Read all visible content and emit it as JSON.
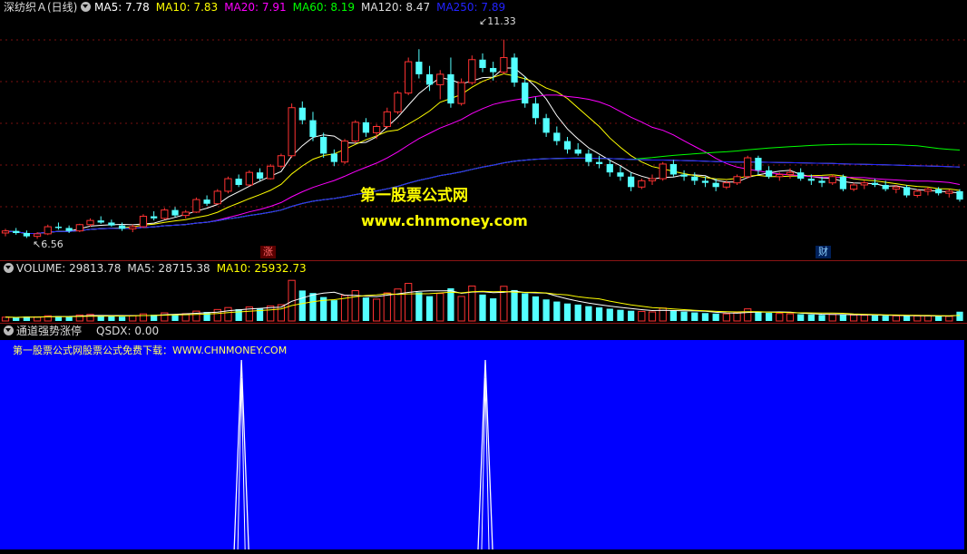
{
  "main": {
    "title": "深纺织Ａ(日线)",
    "ma_legend": [
      {
        "label": "MA5: 7.78",
        "color": "#ffffff"
      },
      {
        "label": "MA10: 7.83",
        "color": "#ffff00"
      },
      {
        "label": "MA20: 7.91",
        "color": "#ff00ff"
      },
      {
        "label": "MA60: 8.19",
        "color": "#00ff00"
      },
      {
        "label": "MA120: 8.47",
        "color": "#dddddd"
      },
      {
        "label": "MA250: 7.89",
        "color": "#2222ff"
      }
    ],
    "high_label": "11.33",
    "low_label": "6.56",
    "tag_zhang": "涨",
    "tag_cai": "财",
    "watermark_title": "第一股票公式网",
    "watermark_url": "www.chnmoney.com"
  },
  "volume": {
    "legend": [
      {
        "label": "VOLUME: 29813.78",
        "color": "#dddddd"
      },
      {
        "label": "MA5: 28715.38",
        "color": "#dddddd"
      },
      {
        "label": "MA10: 25932.73",
        "color": "#ffff00"
      }
    ]
  },
  "indicator": {
    "name": "通道强势涨停",
    "value_label": "QSDX: 0.00",
    "banner": "第一股票公式网股票公式免费下载：WWW.CHNMONEY.COM"
  },
  "colors": {
    "up": "#ff3232",
    "down": "#54ffff",
    "indicator_bg": "#0000ff",
    "separator": "#8a1414"
  },
  "chart_data": {
    "type": "candlestick",
    "price_range": [
      6.2,
      11.8
    ],
    "candles": [
      [
        6.7,
        6.8,
        6.62,
        6.75
      ],
      [
        6.75,
        6.82,
        6.66,
        6.7
      ],
      [
        6.7,
        6.76,
        6.58,
        6.62
      ],
      [
        6.62,
        6.72,
        6.56,
        6.68
      ],
      [
        6.68,
        6.9,
        6.65,
        6.85
      ],
      [
        6.85,
        6.95,
        6.78,
        6.82
      ],
      [
        6.82,
        6.88,
        6.7,
        6.75
      ],
      [
        6.75,
        6.92,
        6.72,
        6.9
      ],
      [
        6.9,
        7.05,
        6.85,
        7.0
      ],
      [
        7.0,
        7.1,
        6.92,
        6.95
      ],
      [
        6.95,
        7.02,
        6.85,
        6.88
      ],
      [
        6.88,
        6.95,
        6.75,
        6.8
      ],
      [
        6.8,
        6.9,
        6.72,
        6.85
      ],
      [
        6.85,
        7.15,
        6.82,
        7.1
      ],
      [
        7.1,
        7.22,
        7.0,
        7.05
      ],
      [
        7.05,
        7.3,
        7.02,
        7.25
      ],
      [
        7.25,
        7.32,
        7.08,
        7.12
      ],
      [
        7.12,
        7.25,
        7.05,
        7.2
      ],
      [
        7.2,
        7.55,
        7.18,
        7.5
      ],
      [
        7.5,
        7.6,
        7.35,
        7.4
      ],
      [
        7.4,
        7.75,
        7.38,
        7.7
      ],
      [
        7.7,
        8.05,
        7.65,
        8.0
      ],
      [
        8.0,
        8.1,
        7.8,
        7.85
      ],
      [
        7.85,
        8.2,
        7.82,
        8.15
      ],
      [
        8.15,
        8.25,
        7.95,
        8.0
      ],
      [
        8.0,
        8.35,
        7.98,
        8.3
      ],
      [
        8.3,
        8.6,
        8.25,
        8.55
      ],
      [
        8.55,
        9.8,
        8.5,
        9.7
      ],
      [
        9.7,
        9.85,
        9.3,
        9.4
      ],
      [
        9.4,
        9.6,
        8.9,
        9.0
      ],
      [
        9.0,
        9.1,
        8.5,
        8.6
      ],
      [
        8.6,
        8.7,
        8.3,
        8.4
      ],
      [
        8.4,
        8.95,
        8.35,
        8.9
      ],
      [
        8.9,
        9.4,
        8.85,
        9.35
      ],
      [
        9.35,
        9.45,
        9.0,
        9.1
      ],
      [
        9.1,
        9.3,
        8.95,
        9.25
      ],
      [
        9.25,
        9.7,
        9.2,
        9.6
      ],
      [
        9.6,
        10.1,
        9.55,
        10.05
      ],
      [
        10.05,
        10.9,
        10.0,
        10.8
      ],
      [
        10.8,
        11.1,
        10.4,
        10.5
      ],
      [
        10.5,
        10.7,
        10.1,
        10.25
      ],
      [
        10.25,
        10.6,
        9.9,
        10.5
      ],
      [
        10.5,
        10.9,
        9.7,
        9.8
      ],
      [
        9.8,
        10.4,
        9.75,
        10.3
      ],
      [
        10.3,
        10.95,
        10.25,
        10.85
      ],
      [
        10.85,
        11.0,
        10.55,
        10.65
      ],
      [
        10.65,
        10.8,
        10.35,
        10.55
      ],
      [
        10.55,
        11.33,
        10.5,
        10.9
      ],
      [
        10.9,
        11.0,
        10.2,
        10.3
      ],
      [
        10.3,
        10.45,
        9.7,
        9.8
      ],
      [
        9.8,
        9.95,
        9.3,
        9.45
      ],
      [
        9.45,
        9.55,
        9.0,
        9.1
      ],
      [
        9.1,
        9.25,
        8.8,
        8.9
      ],
      [
        8.9,
        9.0,
        8.6,
        8.7
      ],
      [
        8.7,
        8.85,
        8.55,
        8.6
      ],
      [
        8.6,
        8.7,
        8.3,
        8.4
      ],
      [
        8.4,
        8.55,
        8.25,
        8.35
      ],
      [
        8.35,
        8.45,
        8.05,
        8.15
      ],
      [
        8.15,
        8.3,
        7.95,
        8.05
      ],
      [
        8.05,
        8.15,
        7.7,
        7.8
      ],
      [
        7.8,
        8.0,
        7.75,
        7.95
      ],
      [
        7.95,
        8.1,
        7.85,
        8.0
      ],
      [
        8.0,
        8.4,
        7.95,
        8.35
      ],
      [
        8.35,
        8.45,
        8.05,
        8.1
      ],
      [
        8.1,
        8.2,
        7.95,
        8.05
      ],
      [
        8.05,
        8.15,
        7.85,
        7.95
      ],
      [
        7.95,
        8.05,
        7.8,
        7.9
      ],
      [
        7.9,
        8.0,
        7.7,
        7.8
      ],
      [
        7.8,
        7.95,
        7.75,
        7.9
      ],
      [
        7.9,
        8.1,
        7.85,
        8.05
      ],
      [
        8.05,
        8.55,
        8.0,
        8.5
      ],
      [
        8.5,
        8.55,
        8.1,
        8.2
      ],
      [
        8.2,
        8.3,
        8.0,
        8.05
      ],
      [
        8.05,
        8.15,
        7.95,
        8.1
      ],
      [
        8.1,
        8.25,
        8.0,
        8.15
      ],
      [
        8.15,
        8.25,
        7.95,
        8.0
      ],
      [
        8.0,
        8.1,
        7.85,
        7.95
      ],
      [
        7.95,
        8.05,
        7.8,
        7.9
      ],
      [
        7.9,
        8.1,
        7.85,
        8.05
      ],
      [
        8.05,
        8.1,
        7.7,
        7.75
      ],
      [
        7.75,
        7.9,
        7.7,
        7.85
      ],
      [
        7.85,
        7.95,
        7.75,
        7.9
      ],
      [
        7.9,
        8.0,
        7.8,
        7.85
      ],
      [
        7.85,
        7.95,
        7.7,
        7.75
      ],
      [
        7.75,
        7.85,
        7.65,
        7.8
      ],
      [
        7.8,
        7.85,
        7.55,
        7.6
      ],
      [
        7.6,
        7.75,
        7.55,
        7.7
      ],
      [
        7.7,
        7.8,
        7.6,
        7.75
      ],
      [
        7.75,
        7.8,
        7.6,
        7.65
      ],
      [
        7.65,
        7.75,
        7.55,
        7.7
      ],
      [
        7.7,
        7.75,
        7.45,
        7.5
      ]
    ],
    "volume_range": [
      0,
      60000
    ],
    "volumes": [
      5200,
      4800,
      6100,
      5500,
      7200,
      6800,
      5900,
      8300,
      9100,
      7800,
      6500,
      6000,
      7400,
      9800,
      8600,
      11200,
      9400,
      10100,
      13600,
      12400,
      15800,
      18500,
      16200,
      19300,
      17100,
      20800,
      22400,
      56000,
      42000,
      38500,
      33000,
      28600,
      35200,
      41800,
      32400,
      30100,
      38700,
      44100,
      51800,
      39600,
      34200,
      37900,
      45100,
      33800,
      48200,
      36400,
      31200,
      47800,
      42600,
      38100,
      33900,
      29700,
      26800,
      24100,
      22600,
      20400,
      18700,
      16900,
      15400,
      14100,
      13200,
      12500,
      17800,
      14300,
      12900,
      11800,
      10900,
      10200,
      9800,
      11300,
      16700,
      13100,
      11200,
      10400,
      9900,
      9300,
      8900,
      8400,
      9100,
      8700,
      8200,
      7900,
      7600,
      7300,
      7100,
      6800,
      7000,
      6900,
      6600,
      6400,
      12800
    ],
    "qsdx": {
      "range": [
        0,
        1
      ],
      "spikes_at_index": [
        22,
        45
      ],
      "value": 0.0
    }
  }
}
